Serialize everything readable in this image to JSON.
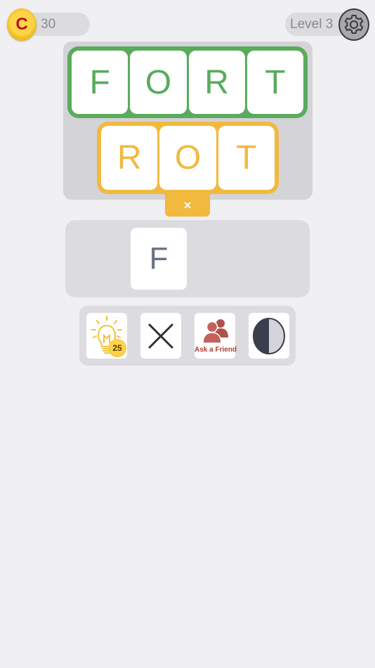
{
  "coins": {
    "symbol": "C",
    "count": "30"
  },
  "level": {
    "label": "Level 3"
  },
  "board": {
    "solved_word": [
      "F",
      "O",
      "R",
      "T"
    ],
    "current_word": [
      "R",
      "O",
      "T"
    ],
    "clear_label": "×"
  },
  "input": {
    "letters": [
      "F"
    ]
  },
  "tools": {
    "hint_cost": "25",
    "ask_friend_label": "Ask a Friend"
  },
  "colors": {
    "green": "#5aab5c",
    "yellow": "#f2b93f",
    "input_letter": "#687284",
    "coin": "#f3c020"
  }
}
